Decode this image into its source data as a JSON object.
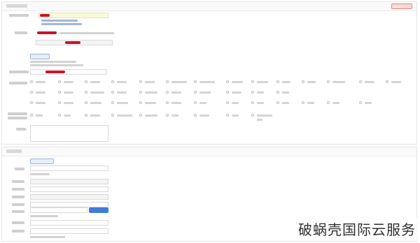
{
  "watermark": {
    "text": "破蜗壳国际云服务"
  },
  "panel1": {
    "title": "",
    "top_right_button": "",
    "fields": [
      {
        "label": "",
        "value": "",
        "redacted": true
      },
      {
        "label": "",
        "value": ""
      },
      {
        "label": "",
        "value": ""
      }
    ],
    "service_type_options": [],
    "remark_label": ""
  },
  "panel2": {
    "title": "",
    "contact_button": "",
    "upload_button": "",
    "fields": [
      {
        "label": "",
        "value": ""
      },
      {
        "label": "",
        "value": ""
      },
      {
        "label": "",
        "value": ""
      },
      {
        "label": "",
        "value": ""
      },
      {
        "label": "",
        "value": ""
      },
      {
        "label": "",
        "value": ""
      }
    ]
  },
  "colors": {
    "redaction": "#c6142a",
    "accent": "#3e7ed8",
    "border": "#d9d9d9",
    "highlight_input": "#fafbd8"
  }
}
